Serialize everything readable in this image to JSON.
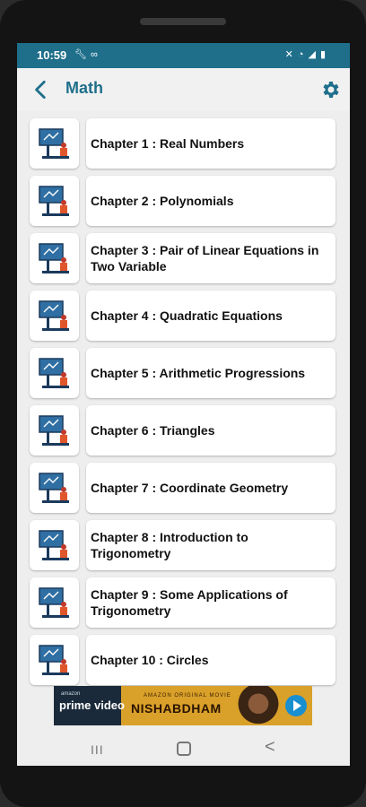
{
  "status_bar": {
    "time": "10:59",
    "left_icons": [
      "wrench-icon",
      "link-icon"
    ],
    "right_icons": [
      "mute-icon",
      "wifi-icon",
      "signal-icon",
      "battery-icon"
    ]
  },
  "app_bar": {
    "title": "Math",
    "back_icon": "back-arrow-icon",
    "settings_icon": "gear-icon",
    "accent_color": "#1f6f8b"
  },
  "chapters": [
    {
      "label": "Chapter 1 : Real Numbers"
    },
    {
      "label": "Chapter 2 : Polynomials"
    },
    {
      "label": "Chapter 3 : Pair of Linear Equations in Two Variable"
    },
    {
      "label": "Chapter 4 : Quadratic Equations"
    },
    {
      "label": "Chapter 5 : Arithmetic Progressions"
    },
    {
      "label": "Chapter 6 : Triangles"
    },
    {
      "label": "Chapter 7 : Coordinate Geometry"
    },
    {
      "label": "Chapter 8 : Introduction to Trigonometry"
    },
    {
      "label": "Chapter 9 : Some Applications of Trigonometry"
    },
    {
      "label": "Chapter 10 : Circles"
    }
  ],
  "ad_banner": {
    "brand_top": "amazon",
    "brand": "prime video",
    "tagline": "AMAZON ORIGINAL MOVIE",
    "movie": "NISHABDHAM"
  },
  "nav_bar": {
    "recent_glyph": "III",
    "back_glyph": "<"
  }
}
